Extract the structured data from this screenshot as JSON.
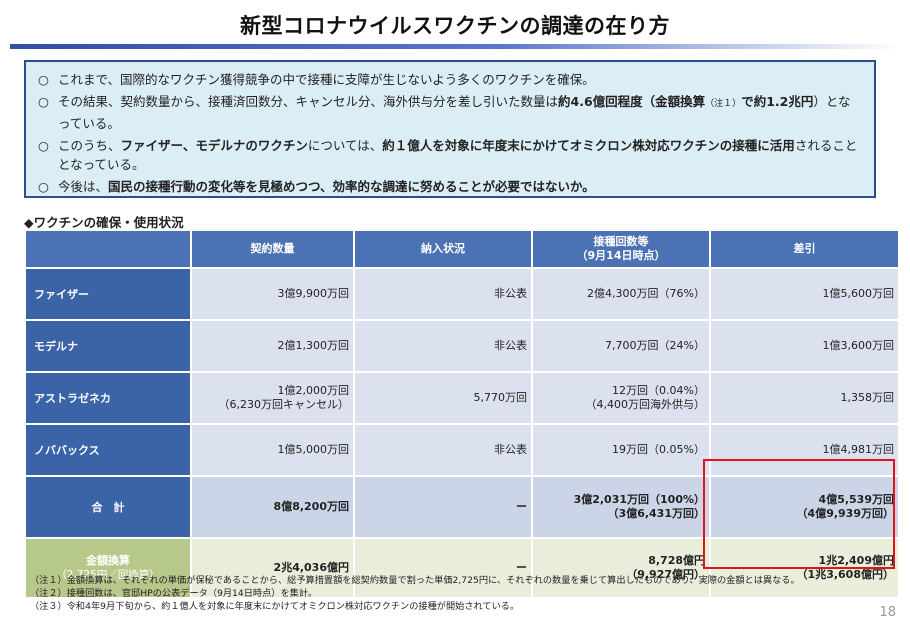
{
  "title": "新型コロナウイルスワクチンの調達の在り方",
  "summary": {
    "bullet": "○",
    "items": [
      {
        "text": "これまで、国際的なワクチン獲得競争の中で接種に支障が生じないよう多くのワクチンを確保。"
      },
      {
        "text_a": "その結果、契約数量から、接種済回数分、キャンセル分、海外供与分を差し引いた数量は",
        "bold_a": "約4.6億回程度（金額換算",
        "note": "（注１）",
        "text_b": "で",
        "bold_b": "約1.2兆円",
        "text_c": "）となっている。"
      },
      {
        "text_a": "このうち、",
        "bold_a": "ファイザー、モデルナのワクチン",
        "text_b": "については、",
        "bold_b": "約１億人を対象に年度末にかけてオミクロン株対応ワクチンの接種に活用",
        "text_c": "されることとなっている。"
      },
      {
        "text_a": "今後は、",
        "bold_a": "国民の接種行動の変化等を見極めつつ、効率的な調達に努めることが必要ではないか。"
      }
    ]
  },
  "section_heading": "◆ワクチンの確保・使用状況",
  "table": {
    "headers": [
      "契約数量",
      "納入状況",
      "接種回数等",
      "（9月14日時点）",
      "差引"
    ],
    "rows": [
      {
        "name": "ファイザー",
        "contract": "3億9,900万回",
        "delivery": "非公表",
        "doses": "2億4,300万回（76%）",
        "diff": "1億5,600万回"
      },
      {
        "name": "モデルナ",
        "contract": "2億1,300万回",
        "delivery": "非公表",
        "doses": "7,700万回（24%）",
        "diff": "1億3,600万回"
      },
      {
        "name": "アストラゼネカ",
        "contract": "1億2,000万回",
        "contract_sub": "（6,230万回キャンセル）",
        "delivery": "5,770万回",
        "doses": "12万回（0.04%）",
        "doses_sub": "（4,400万回海外供与）",
        "diff": "1,358万回"
      },
      {
        "name": "ノババックス",
        "contract": "1億5,000万回",
        "delivery": "非公表",
        "doses": "19万回（0.05%）",
        "diff": "1億4,981万回"
      }
    ],
    "total": {
      "name": "合　計",
      "contract": "8億8,200万回",
      "delivery": "ー",
      "doses": "3億2,031万回（100%）",
      "doses_sub": "（3億6,431万回）",
      "diff": "4億5,539万回",
      "diff_sub": "（4億9,939万回）"
    },
    "money": {
      "name": "金額換算",
      "name_sub": "（2,725円／回換算）",
      "contract": "2兆4,036億円",
      "delivery": "ー",
      "doses": "8,728億円",
      "doses_sub": "（9,927億円）",
      "diff": "1兆2,409億円",
      "diff_sub": "（1兆3,608億円）"
    }
  },
  "notes": [
    "（注１）金額換算は、それぞれの単価が保秘であることから、総予算措置額を総契約数量で割った単価2,725円に、それぞれの数量を乗じて算出したものであり、実際の金額とは異なる。",
    "（注２）接種回数は、官邸HPの公表データ（9月14日時点）を集計。",
    "（注３）令和4年9月下旬から、約１億人を対象に年度末にかけてオミクロン株対応ワクチンの接種が開始されている。"
  ],
  "page_number": "18",
  "colors": {
    "header_blue": "#4a72b4",
    "row_blue": "#3b63a8",
    "highlight_red": "#e0151a",
    "summary_bg": "#dbeef5",
    "green": "#b6c98a"
  }
}
